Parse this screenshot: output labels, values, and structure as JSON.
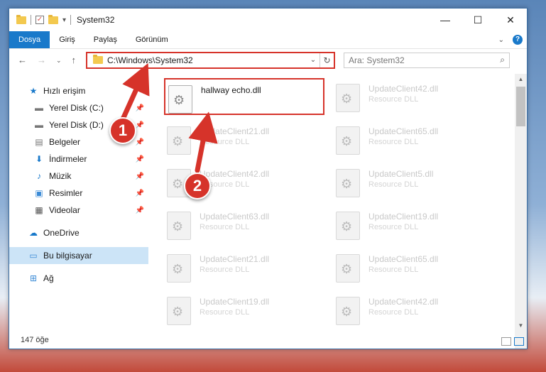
{
  "window": {
    "title": "System32",
    "controls": {
      "minimize": "—",
      "maximize": "☐",
      "close": "✕"
    }
  },
  "ribbon": {
    "tabs": [
      "Dosya",
      "Giriş",
      "Paylaş",
      "Görünüm"
    ]
  },
  "address": {
    "path": "C:\\Windows\\System32",
    "search_placeholder": "Ara: System32"
  },
  "sidebar": {
    "quick_access": "Hızlı erişim",
    "quick_items": [
      "Yerel Disk (C:)",
      "Yerel Disk (D:)",
      "Belgeler",
      "İndirmeler",
      "Müzik",
      "Resimler",
      "Videolar"
    ],
    "onedrive": "OneDrive",
    "this_pc": "Bu bilgisayar",
    "network": "Ağ"
  },
  "status": {
    "count": "147 öğe"
  },
  "files": [
    {
      "name": "hallway echo.dll",
      "type": ""
    },
    {
      "name": "UpdateClient42.dll",
      "type": "Resource DLL"
    },
    {
      "name": "UpdateClient21.dll",
      "type": "Resource DLL"
    },
    {
      "name": "UpdateClient65.dll",
      "type": "Resource DLL"
    },
    {
      "name": "UpdateClient42.dll",
      "type": "Resource DLL"
    },
    {
      "name": "UpdateClient5.dll",
      "type": "Resource DLL"
    },
    {
      "name": "UpdateClient63.dll",
      "type": "Resource DLL"
    },
    {
      "name": "UpdateClient19.dll",
      "type": "Resource DLL"
    },
    {
      "name": "UpdateClient21.dll",
      "type": "Resource DLL"
    },
    {
      "name": "UpdateClient65.dll",
      "type": "Resource DLL"
    },
    {
      "name": "UpdateClient19.dll",
      "type": "Resource DLL"
    },
    {
      "name": "UpdateClient42.dll",
      "type": "Resource DLL"
    }
  ],
  "annotations": {
    "step1": "1",
    "step2": "2"
  },
  "colors": {
    "accent": "#1979ca",
    "highlight": "#d6332a",
    "selection": "#cce4f7"
  }
}
